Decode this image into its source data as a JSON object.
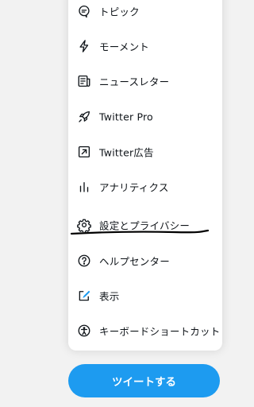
{
  "menu": {
    "items": [
      {
        "label": "トピック",
        "icon": "topics-icon"
      },
      {
        "label": "モーメント",
        "icon": "moments-icon"
      },
      {
        "label": "ニュースレター",
        "icon": "newsletter-icon"
      },
      {
        "label": "Twitter Pro",
        "icon": "rocket-icon"
      },
      {
        "label": "Twitter広告",
        "icon": "ads-icon"
      },
      {
        "label": "アナリティクス",
        "icon": "analytics-icon"
      },
      {
        "label": "設定とプライバシー",
        "icon": "gear-icon"
      },
      {
        "label": "ヘルプセンター",
        "icon": "help-icon"
      },
      {
        "label": "表示",
        "icon": "display-icon"
      },
      {
        "label": "キーボードショートカット",
        "icon": "accessibility-icon"
      }
    ]
  },
  "tweet_button": {
    "label": "ツイートする"
  },
  "colors": {
    "accent": "#1d9bf0",
    "text": "#0f1419",
    "background": "#f2f2f2",
    "annotation": "#000000"
  }
}
